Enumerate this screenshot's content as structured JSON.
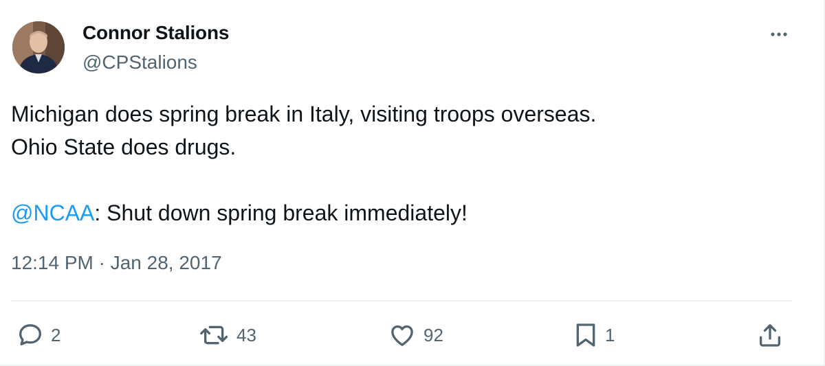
{
  "author": {
    "display_name": "Connor Stalions",
    "handle": "@CPStalions"
  },
  "tweet": {
    "line1": "Michigan does spring break in Italy, visiting troops overseas.",
    "line2": "Ohio State does drugs.",
    "mention": "@NCAA",
    "line4_rest": ": Shut down spring break immediately!",
    "timestamp": "12:14 PM · Jan 28, 2017"
  },
  "actions": {
    "replies": "2",
    "retweets": "43",
    "likes": "92",
    "bookmarks": "1"
  },
  "colors": {
    "text": "#0f1419",
    "secondary": "#536471",
    "link": "#1d9bf0",
    "divider": "#eff3f4"
  },
  "icons": [
    "more-icon",
    "reply-icon",
    "retweet-icon",
    "like-icon",
    "bookmark-icon",
    "share-icon"
  ]
}
